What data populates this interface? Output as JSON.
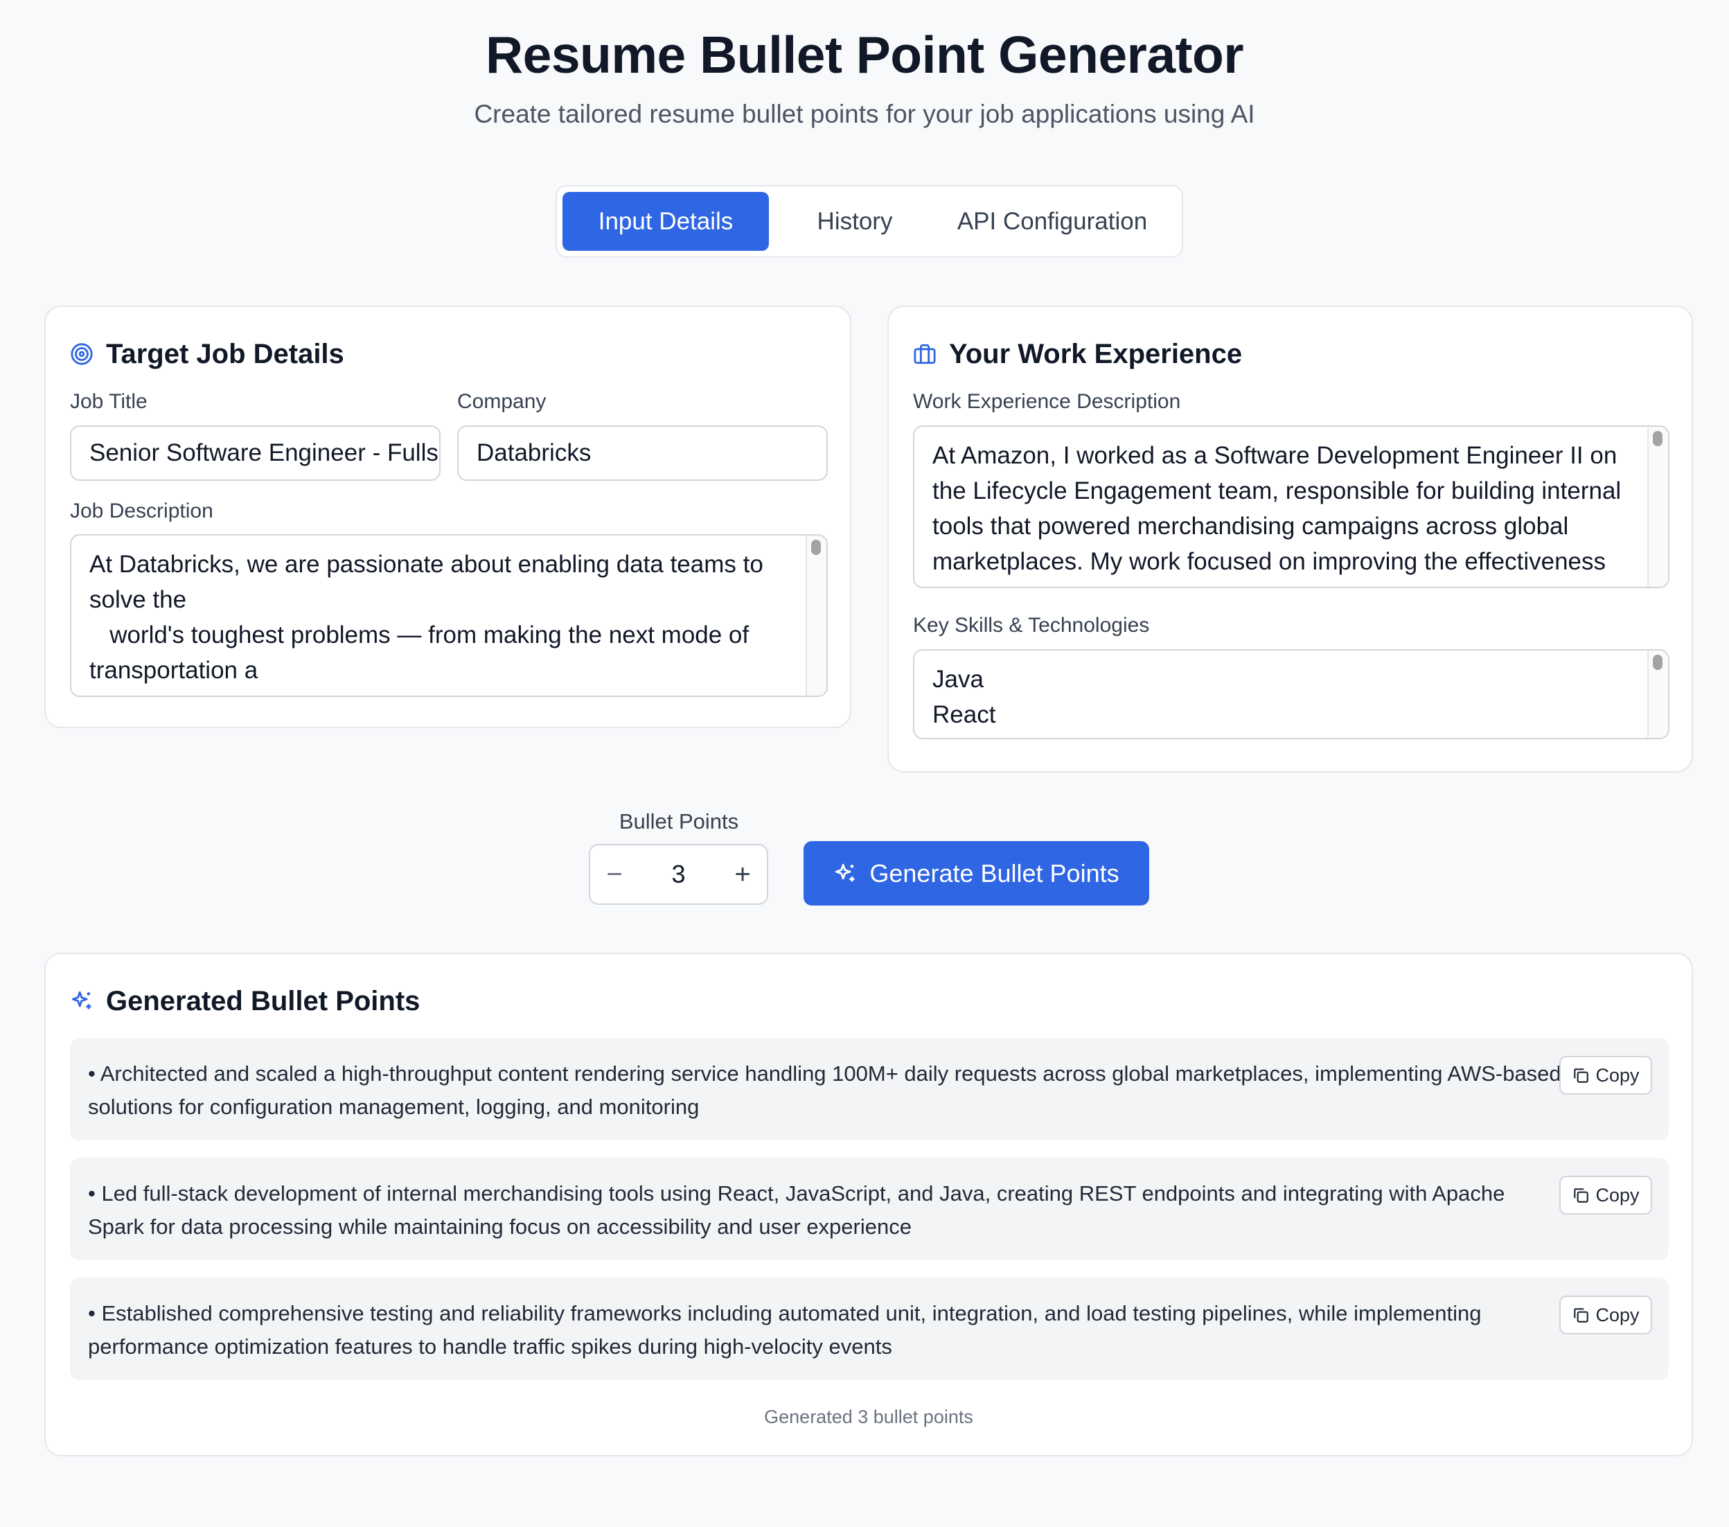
{
  "header": {
    "title": "Resume Bullet Point Generator",
    "subtitle": "Create tailored resume bullet points for your job applications using AI"
  },
  "tabs": [
    {
      "label": "Input Details",
      "active": true
    },
    {
      "label": "History",
      "active": false
    },
    {
      "label": "API Configuration",
      "active": false
    }
  ],
  "job": {
    "heading": "Target Job Details",
    "icon": "target-icon",
    "title_label": "Job Title",
    "title_value": "Senior Software Engineer - Fulls",
    "company_label": "Company",
    "company_value": "Databricks",
    "desc_label": "Job Description",
    "desc_value": "At Databricks, we are passionate about enabling data teams to solve the\n   world's toughest problems — from making the next mode of transportation a\n   reality to accelerating the development of medical breakthroughs."
  },
  "experience": {
    "heading": "Your Work Experience",
    "icon": "briefcase-icon",
    "desc_label": "Work Experience Description",
    "desc_value": "At Amazon, I worked as a Software Development Engineer II on the Lifecycle Engagement team, responsible for building internal tools that powered merchandising campaigns across global marketplaces. My work focused on improving the effectiveness and efficiency of the teams who depend on our tools.",
    "skills_label": "Key Skills & Technologies",
    "skills_value": "Java\nReact\nJavaScript"
  },
  "controls": {
    "bullet_points_label": "Bullet Points",
    "bullet_points_value": "3",
    "minus_symbol": "−",
    "plus_symbol": "+",
    "generate_label": "Generate Bullet Points"
  },
  "generated": {
    "heading": "Generated Bullet Points",
    "copy_label": "Copy",
    "items": [
      "• Architected and scaled a high-throughput content rendering service handling 100M+ daily requests across global marketplaces, implementing AWS-based solutions for configuration management, logging, and monitoring",
      "• Led full-stack development of internal merchandising tools using React, JavaScript, and Java, creating REST endpoints and integrating with Apache Spark for data processing while maintaining focus on accessibility and user experience",
      "• Established comprehensive testing and reliability frameworks including automated unit, integration, and load testing pipelines, while implementing performance optimization features to handle traffic spikes during high-velocity events"
    ],
    "footer": "Generated 3 bullet points"
  },
  "colors": {
    "primary": "#2f66e3",
    "background": "#f8f9fb",
    "card": "#ffffff",
    "result_bg": "#f3f4f6"
  }
}
